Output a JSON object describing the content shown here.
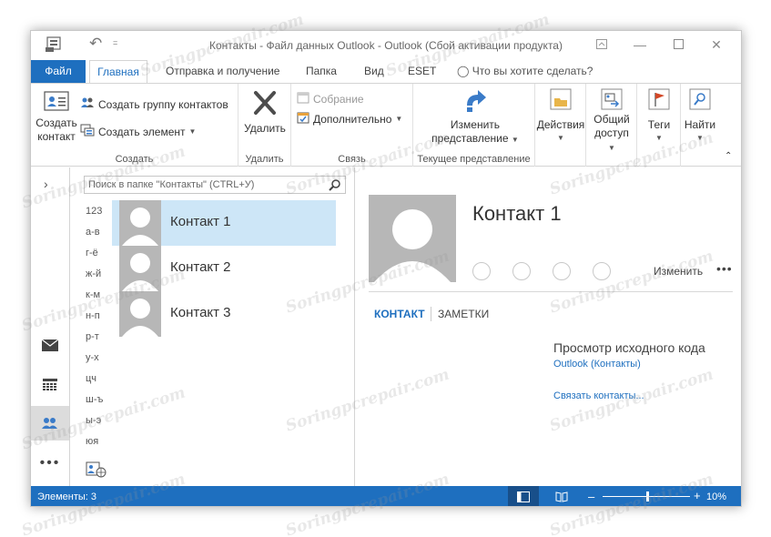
{
  "titlebar": {
    "title": "Контакты - Файл данных Outlook - Outlook (Сбой активации продукта)",
    "quick_access_caret": "="
  },
  "tabs": {
    "file": "Файл",
    "home": "Главная",
    "send_receive": "Отправка и получение",
    "folder": "Папка",
    "view": "Вид",
    "eset": "ESET",
    "tell_me": "Что вы хотите сделать?"
  },
  "ribbon": {
    "create": {
      "new_contact": "Создать контакт",
      "new_group": "Создать группу контактов",
      "new_item": "Создать элемент",
      "label": "Создать"
    },
    "delete": {
      "delete": "Удалить",
      "label": "Удалить"
    },
    "communicate": {
      "meeting": "Собрание",
      "more": "Дополнительно",
      "label": "Связь"
    },
    "current_view": {
      "change_view": "Изменить представление",
      "label": "Текущее представление"
    },
    "actions": "Действия",
    "share": "Общий доступ",
    "tags": "Теги",
    "find": "Найти"
  },
  "list": {
    "search_placeholder": "Поиск в папке \"Контакты\" (CTRL+У)",
    "alphabet": [
      "123",
      "а-в",
      "г-ё",
      "ж-й",
      "к-м",
      "н-п",
      "р-т",
      "у-х",
      "цч",
      "ш-ъ",
      "ы-э",
      "юя"
    ],
    "contacts": [
      "Контакт 1",
      "Контакт 2",
      "Контакт 3"
    ]
  },
  "reading": {
    "name": "Контакт 1",
    "edit": "Изменить",
    "more": "•••",
    "tab_contact": "КОНТАКТ",
    "tab_notes": "ЗАМЕТКИ",
    "source_title": "Просмотр исходного кода",
    "source_link": "Outlook (Контакты)",
    "link_contacts": "Связать контакты..."
  },
  "statusbar": {
    "items": "Элементы: 3",
    "zoom": "10%"
  },
  "watermark": "Soringpcrepair.com",
  "colors": {
    "accent": "#1e6fbf",
    "selected": "#cde6f7",
    "photo": "#b7b7b7"
  }
}
